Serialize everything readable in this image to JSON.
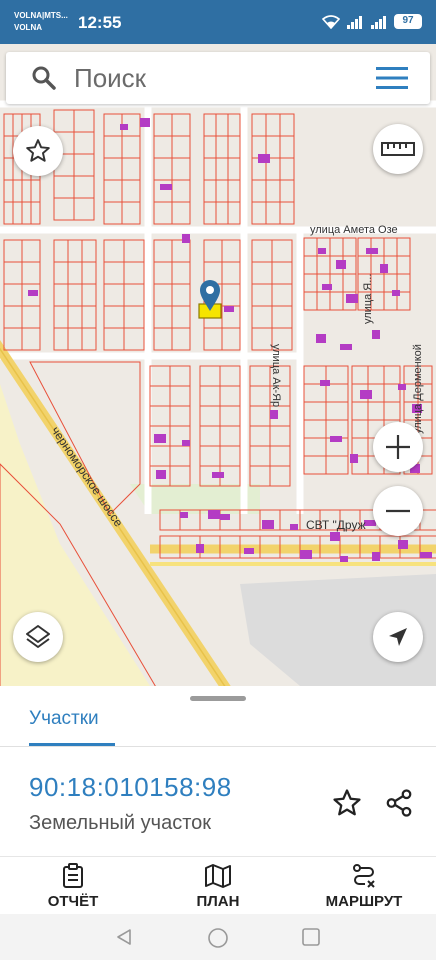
{
  "status_bar": {
    "carrier_line1": "VOLNA|MTS...",
    "carrier_line2": "VOLNA",
    "time": "12:55",
    "battery": "97"
  },
  "search": {
    "placeholder": "Поиск"
  },
  "map": {
    "streets": {
      "ameta": "улица Амета Озе",
      "akyar": "улица Ак-Яр",
      "ulica_left": "улица Я...",
      "dermenkoy": "улица Дерменкой",
      "shosse": "черноморское шоссе",
      "sov": "СВТ \"Друж"
    },
    "icons": {
      "favorite": "star-icon",
      "ruler": "ruler-icon",
      "zoom_in": "plus-icon",
      "zoom_out": "minus-icon",
      "layers": "layers-icon",
      "locate": "navigation-arrow-icon",
      "marker": "location-pin-icon"
    },
    "parcel_highlight_color": "#f5e400",
    "boundary_color": "#e8503a",
    "building_color": "#b43cc4"
  },
  "sheet": {
    "tab_label": "Участки",
    "cadastral_number": "90:18:010158:98",
    "parcel_type": "Земельный участок"
  },
  "bottom_nav": {
    "report": "ОТЧЁТ",
    "plan": "ПЛАН",
    "route": "МАРШРУТ"
  },
  "accent_color": "#2f7fbf"
}
